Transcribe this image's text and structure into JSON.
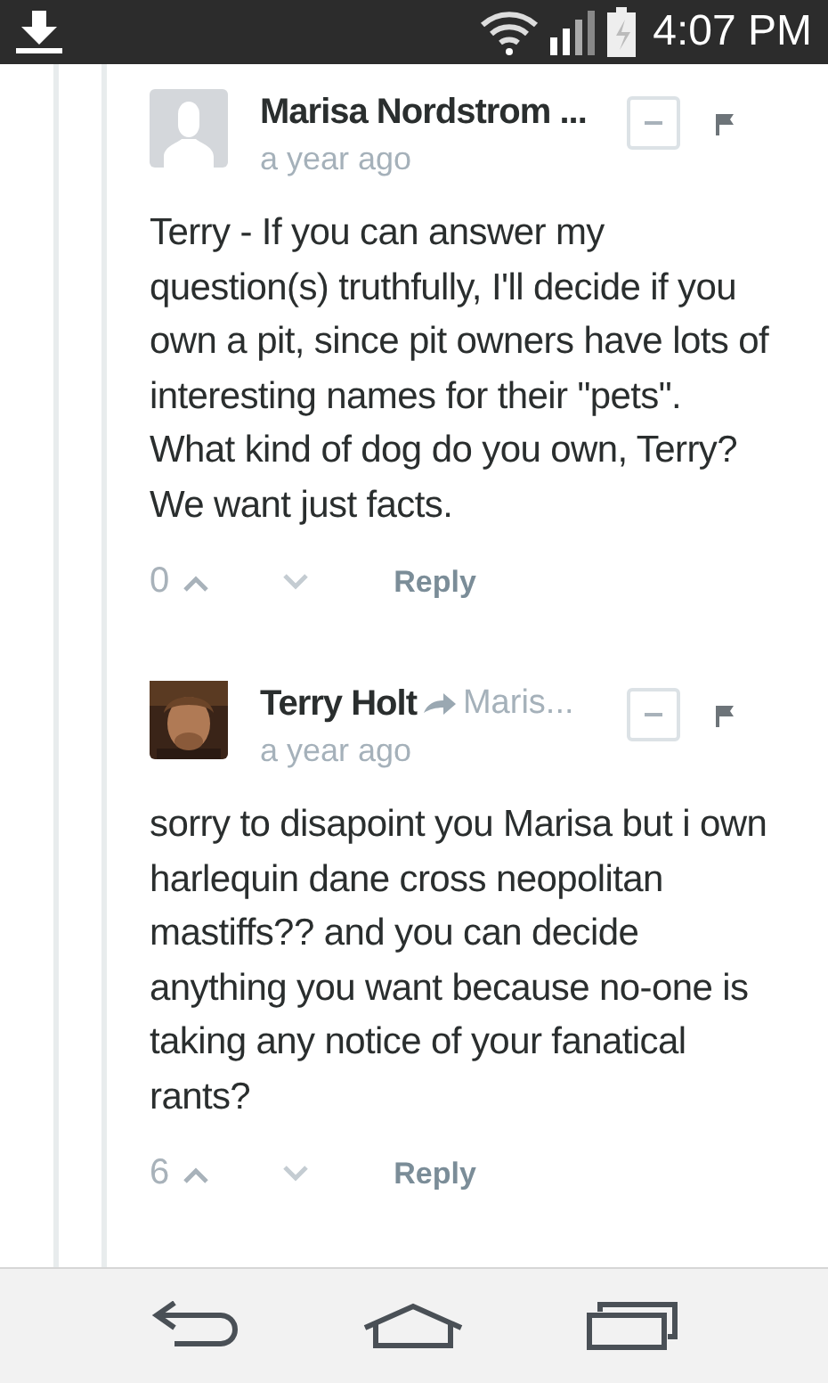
{
  "status_bar": {
    "time": "4:07 PM"
  },
  "comments": [
    {
      "author": "Marisa Nordstrom ...",
      "avatar": {
        "kind": "default"
      },
      "time": "a year ago",
      "body": "Terry - If you can answer my question(s) truthfully, I'll decide if you own a pit, since pit owners have lots of interesting names for their \"pets\". What kind of dog do you own, Terry? We want just facts.",
      "votes": "0",
      "reply_label": "Reply"
    },
    {
      "author": "Terry Holt",
      "reply_to": "Maris...",
      "time": "a year ago",
      "body": "sorry to disapoint you Marisa but i own harlequin dane cross neopolitan mastiffs?? and you can decide anything you want because no-one is taking any notice of your fanatical rants?",
      "votes": "6",
      "reply_label": "Reply"
    }
  ]
}
